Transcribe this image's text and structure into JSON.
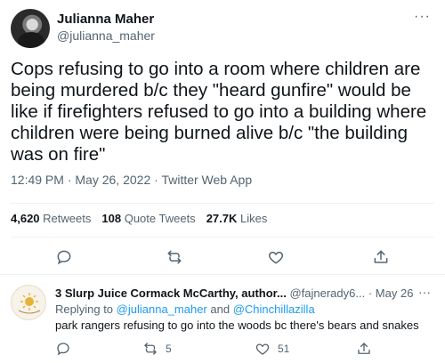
{
  "tweet": {
    "author_name": "Julianna Maher",
    "author_handle": "@julianna_maher",
    "more": "···",
    "text": "Cops refusing to go into a room where children are being murdered b/c they \"heard gunfire\" would be like if firefighters refused to go into a building where children were being burned alive b/c \"the building was on fire\"",
    "time": "12:49 PM",
    "date": "May 26, 2022",
    "source": "Twitter Web App",
    "retweets_count": "4,620",
    "retweets_label": "Retweets",
    "quotes_count": "108",
    "quotes_label": "Quote Tweets",
    "likes_count": "27.7K",
    "likes_label": "Likes"
  },
  "reply": {
    "author_name": "3 Slurp Juice Cormack McCarthy, author...",
    "author_handle": "@fajneradу6...",
    "date": "May 26",
    "more": "···",
    "replying_prefix": "Replying to",
    "replying_user1": "@julianna_maher",
    "replying_and": "and",
    "replying_user2": "@Chinchillazilla",
    "text": "park rangers refusing to go into the woods bc there's bears and snakes",
    "retweet_count": "5",
    "like_count": "51"
  },
  "colors": {
    "text": "#0f1419",
    "secondary": "#536471",
    "link": "#1d9bf0",
    "divider": "#eff3f4"
  },
  "icons": [
    "reply-icon",
    "retweet-icon",
    "like-icon",
    "share-icon",
    "more-icon"
  ]
}
